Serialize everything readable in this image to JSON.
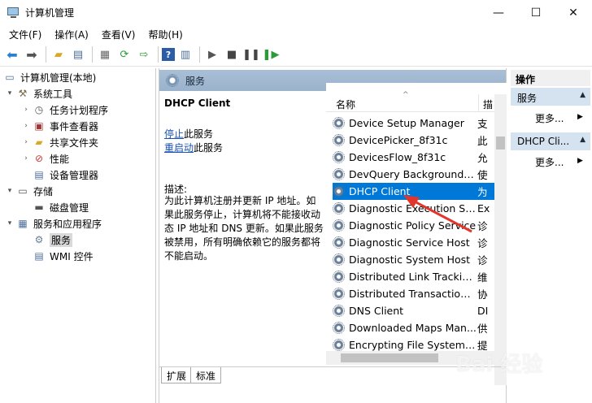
{
  "window": {
    "title": "计算机管理",
    "minimize": "—",
    "maximize": "☐",
    "close": "✕"
  },
  "menu": [
    "文件(F)",
    "操作(A)",
    "查看(V)",
    "帮助(H)"
  ],
  "tree": {
    "root": "计算机管理(本地)",
    "system_tools": "系统工具",
    "task_scheduler": "任务计划程序",
    "event_viewer": "事件查看器",
    "shared_folders": "共享文件夹",
    "performance": "性能",
    "device_manager": "设备管理器",
    "storage": "存储",
    "disk_management": "磁盘管理",
    "services_apps": "服务和应用程序",
    "services": "服务",
    "wmi": "WMI 控件"
  },
  "center": {
    "header": "服务",
    "selected_title": "DHCP Client",
    "stop_link": "停止",
    "stop_suffix": "此服务",
    "restart_link": "重启动",
    "restart_suffix": "此服务",
    "description_label": "描述:",
    "description": "为此计算机注册并更新 IP 地址。如果此服务停止，计算机将不能接收动态 IP 地址和 DNS 更新。如果此服务被禁用，所有明确依赖它的服务都将不能启动。"
  },
  "list": {
    "col_name": "名称",
    "col_desc": "描",
    "rows": [
      {
        "name": "Device Setup Manager",
        "desc": "支"
      },
      {
        "name": "DevicePicker_8f31c",
        "desc": "此"
      },
      {
        "name": "DevicesFlow_8f31c",
        "desc": "允"
      },
      {
        "name": "DevQuery Background D...",
        "desc": "使"
      },
      {
        "name": "DHCP Client",
        "desc": "为"
      },
      {
        "name": "Diagnostic Execution Ser...",
        "desc": "Ex"
      },
      {
        "name": "Diagnostic Policy Service",
        "desc": "诊"
      },
      {
        "name": "Diagnostic Service Host",
        "desc": "诊"
      },
      {
        "name": "Diagnostic System Host",
        "desc": "诊"
      },
      {
        "name": "Distributed Link Tracking...",
        "desc": "维"
      },
      {
        "name": "Distributed Transaction C...",
        "desc": "协"
      },
      {
        "name": "DNS Client",
        "desc": "DI"
      },
      {
        "name": "Downloaded Maps Man...",
        "desc": "供"
      },
      {
        "name": "Encrypting File System (E...",
        "desc": "提"
      }
    ]
  },
  "tabs": [
    "扩展",
    "标准"
  ],
  "actions": {
    "header": "操作",
    "section1": "服务",
    "more1": "更多...",
    "section2": "DHCP Cli...",
    "more2": "更多..."
  },
  "watermark": "Bai 经验"
}
